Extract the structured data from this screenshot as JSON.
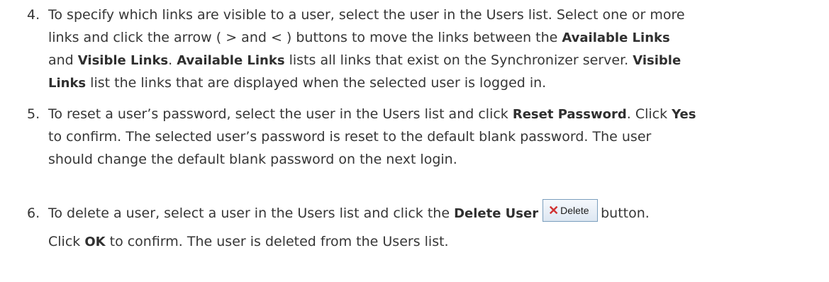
{
  "steps": [
    {
      "number": "4.",
      "lines": [
        [
          {
            "t": "To specify which links are visible to a user, select the user in the Users list. Select one or more"
          }
        ],
        [
          {
            "t": "links and click the arrow ( > and < ) buttons to move the links between the "
          },
          {
            "t": "Available Links",
            "b": true
          }
        ],
        [
          {
            "t": "and "
          },
          {
            "t": "Visible Links",
            "b": true
          },
          {
            "t": ". "
          },
          {
            "t": "Available Links",
            "b": true
          },
          {
            "t": " lists all links that exist on the Synchronizer server. "
          },
          {
            "t": "Visible",
            "b": true
          }
        ],
        [
          {
            "t": "Links",
            "b": true
          },
          {
            "t": " list the links that are displayed when the selected user is logged in."
          }
        ]
      ]
    },
    {
      "number": "5.",
      "lines": [
        [
          {
            "t": "To reset a user’s password, select the user in the Users list and click "
          },
          {
            "t": "Reset Password",
            "b": true
          },
          {
            "t": ". Click "
          },
          {
            "t": "Yes",
            "b": true
          }
        ],
        [
          {
            "t": "to confirm. The selected user’s password is reset to the default blank password. The user"
          }
        ],
        [
          {
            "t": "should change the default blank password on the next login."
          }
        ]
      ]
    },
    {
      "number": "6.",
      "line1_before": "To delete a user, select a user in the Users list and click the ",
      "line1_bold": "Delete User",
      "delete_button_label": "Delete",
      "line1_after": "button.",
      "line2_before": "Click ",
      "line2_bold": "OK",
      "line2_after": " to confirm. The user is deleted from the Users list."
    }
  ],
  "colors": {
    "text": "#363636",
    "button_border": "#7b9ebd",
    "delete_icon": "#d03030"
  },
  "icons": {
    "delete_button_icon": "close-x-icon"
  }
}
